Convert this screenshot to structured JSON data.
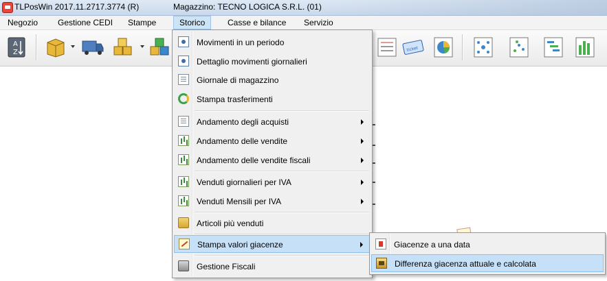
{
  "titlebar": {
    "app_title": "TLPosWin 2017.11.2717.3774 (R)",
    "window_title": "Magazzino: TECNO LOGICA S.R.L. (01)"
  },
  "menubar": {
    "items": [
      {
        "label": "Negozio"
      },
      {
        "label": "Gestione CEDI"
      },
      {
        "label": "Stampe"
      },
      {
        "label": "Storico"
      },
      {
        "label": "Casse e bilance"
      },
      {
        "label": "Servizio"
      }
    ],
    "active": "Storico"
  },
  "toolbar": {
    "buttons": [
      {
        "icon": "sort-az-icon"
      },
      {
        "icon": "box-icon"
      },
      {
        "icon": "truck-icon"
      },
      {
        "icon": "boxes-icon"
      },
      {
        "icon": "colored-boxes-icon"
      },
      {
        "icon": "list-chart-icon"
      },
      {
        "icon": "ticket-icon"
      },
      {
        "icon": "pie-chart-icon"
      },
      {
        "icon": "network-icon"
      },
      {
        "icon": "scatter-icon"
      },
      {
        "icon": "gantt-icon"
      },
      {
        "icon": "bar-chart-icon"
      }
    ]
  },
  "dropdown": {
    "items": [
      {
        "label": "Movimenti in un periodo",
        "icon": "movements-icon",
        "submenu": false
      },
      {
        "label": "Dettaglio movimenti giornalieri",
        "icon": "daily-details-icon",
        "submenu": false
      },
      {
        "label": "Giornale di magazzino",
        "icon": "warehouse-journal-icon",
        "submenu": false
      },
      {
        "label": "Stampa trasferimenti",
        "icon": "transfers-icon",
        "submenu": false
      },
      {
        "label": "Andamento degli acquisti",
        "icon": "purchases-icon",
        "submenu": true
      },
      {
        "label": "Andamento delle vendite",
        "icon": "sales-trend-icon",
        "submenu": true
      },
      {
        "label": "Andamento delle vendite fiscali",
        "icon": "fiscal-sales-icon",
        "submenu": true
      },
      {
        "label": "Venduti giornalieri per IVA",
        "icon": "daily-vat-icon",
        "submenu": true
      },
      {
        "label": "Venduti Mensili per IVA",
        "icon": "monthly-vat-icon",
        "submenu": true
      },
      {
        "label": "Articoli più venduti",
        "icon": "top-items-icon",
        "submenu": false
      },
      {
        "label": "Stampa valori giacenze",
        "icon": "stock-values-icon",
        "submenu": true,
        "highlighted": true
      },
      {
        "label": "Gestione Fiscali",
        "icon": "fiscal-management-icon",
        "submenu": false
      }
    ]
  },
  "submenu": {
    "items": [
      {
        "label": "Giacenze a una data",
        "icon": "stock-date-icon"
      },
      {
        "label": "Differenza giacenza attuale e calcolata",
        "icon": "stock-difference-icon",
        "highlighted": true
      }
    ]
  },
  "colors": {
    "highlight": "#c5e0f7",
    "highlight_border": "#8fc0ea",
    "menu_bg": "#f0f0f0"
  }
}
